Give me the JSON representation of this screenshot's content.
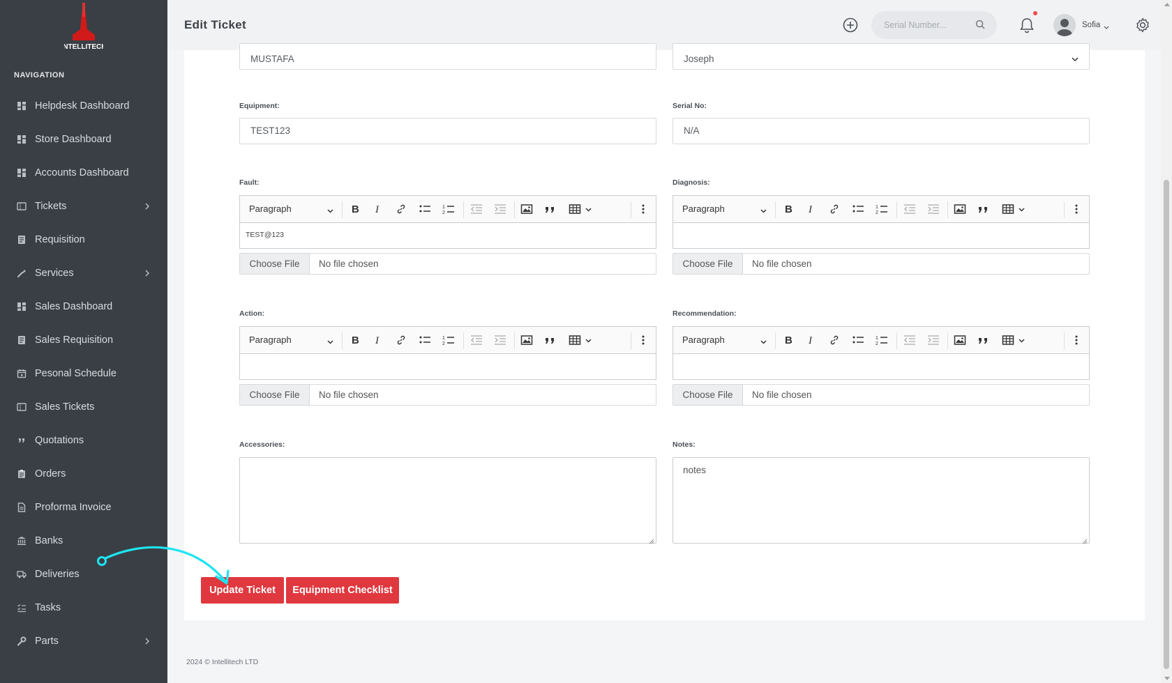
{
  "app": {
    "logo_text": "INTELLITECH"
  },
  "sidebar": {
    "title": "NAVIGATION",
    "items": [
      {
        "label": "Helpdesk Dashboard",
        "icon": "dashboard-icon",
        "has_children": false
      },
      {
        "label": "Store Dashboard",
        "icon": "dashboard-icon",
        "has_children": false
      },
      {
        "label": "Accounts Dashboard",
        "icon": "dashboard-icon",
        "has_children": false
      },
      {
        "label": "Tickets",
        "icon": "ticket-icon",
        "has_children": true
      },
      {
        "label": "Requisition",
        "icon": "document-icon",
        "has_children": false
      },
      {
        "label": "Services",
        "icon": "wrench-icon",
        "has_children": true
      },
      {
        "label": "Sales Dashboard",
        "icon": "dashboard-icon",
        "has_children": false
      },
      {
        "label": "Sales Requisition",
        "icon": "document-icon",
        "has_children": false
      },
      {
        "label": "Pesonal Schedule",
        "icon": "calendar-icon",
        "has_children": false
      },
      {
        "label": "Sales Tickets",
        "icon": "ticket-icon",
        "has_children": false
      },
      {
        "label": "Quotations",
        "icon": "quote-icon",
        "has_children": false
      },
      {
        "label": "Orders",
        "icon": "clipboard-icon",
        "has_children": false
      },
      {
        "label": "Proforma Invoice",
        "icon": "invoice-icon",
        "has_children": false
      },
      {
        "label": "Banks",
        "icon": "bank-icon",
        "has_children": false
      },
      {
        "label": "Deliveries",
        "icon": "truck-icon",
        "has_children": false
      },
      {
        "label": "Tasks",
        "icon": "tasks-icon",
        "has_children": false
      },
      {
        "label": "Parts",
        "icon": "tool-icon",
        "has_children": true
      }
    ]
  },
  "header": {
    "title": "Edit Ticket",
    "search_placeholder": "Serial Number...",
    "user_name": "Sofia"
  },
  "form": {
    "customer_value": "MUSTAFA",
    "technician_value": "Joseph",
    "equipment_label": "Equipment:",
    "equipment_value": "TEST123",
    "serial_label": "Serial No:",
    "serial_value": "N/A",
    "fault_label": "Fault:",
    "fault_body": "TEST@123",
    "diagnosis_label": "Diagnosis:",
    "diagnosis_body": "",
    "action_label": "Action:",
    "action_body": "",
    "recommendation_label": "Recommendation:",
    "recommendation_body": "",
    "paragraph_option": "Paragraph",
    "choose_file_label": "Choose File",
    "no_file_text": "No file chosen",
    "accessories_label": "Accessories:",
    "accessories_value": "",
    "notes_label": "Notes:",
    "notes_value": "notes"
  },
  "buttons": {
    "update": "Update Ticket",
    "checklist": "Equipment Checklist"
  },
  "footer": {
    "text": "2024 © Intellitech LTD"
  },
  "colors": {
    "sidebar_bg": "#3a3f45",
    "accent_red": "#e0383f",
    "annotation": "#1ee4f0"
  }
}
